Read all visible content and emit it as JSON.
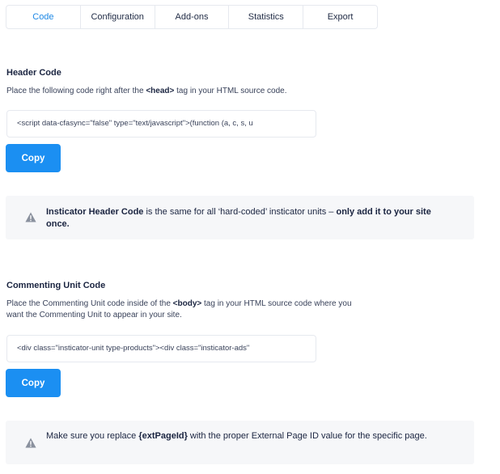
{
  "tabs": [
    {
      "label": "Code",
      "active": true
    },
    {
      "label": "Configuration",
      "active": false
    },
    {
      "label": "Add-ons",
      "active": false
    },
    {
      "label": "Statistics",
      "active": false
    },
    {
      "label": "Export",
      "active": false
    }
  ],
  "header_code": {
    "title": "Header Code",
    "desc_before": "Place the following code right after the ",
    "desc_tag": "<head>",
    "desc_after": " tag in your HTML source code.",
    "code": "<script data-cfasync=\"false\" type=\"text/javascript\">(function (a, c, s, u",
    "copy_label": "Copy"
  },
  "header_notice": {
    "icon": "warning-icon",
    "bold_start": "Insticator Header Code",
    "middle": " is the same for all ‘hard-coded’ insticator units – ",
    "bold_end": "only add it to your site once."
  },
  "commenting_code": {
    "title": "Commenting Unit Code",
    "desc_before": "Place the Commenting Unit code inside of the ",
    "desc_tag": "<body>",
    "desc_after": " tag in your HTML source code where you want the Commenting Unit to appear in your site.",
    "code": "<div class=\"insticator-unit type-products\"><div class=\"insticator-ads\"",
    "copy_label": "Copy"
  },
  "commenting_notice": {
    "icon": "warning-icon",
    "before": "Make sure you replace ",
    "bold": "{extPageId}",
    "after": " with the proper External Page ID value for the specific page."
  },
  "colors": {
    "accent": "#1b8ff2",
    "active_tab": "#1e88e5",
    "notice_bg": "#f6f7f9",
    "warning_icon": "#8a919e"
  }
}
